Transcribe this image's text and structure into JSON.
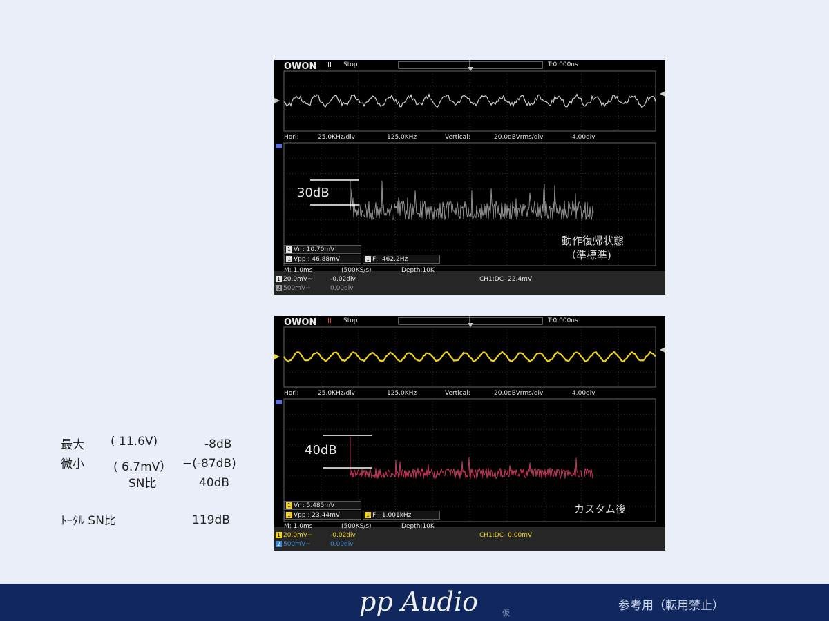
{
  "scope1": {
    "logo": "OWON",
    "run_icon": "II",
    "status": "Stop",
    "trigger_time": "T:0.000ns",
    "fft_info": {
      "hori_label": "Hori:",
      "hori": "25.0KHz/div",
      "center": "125.0KHz",
      "vert_label": "Vertical:",
      "vert": "20.0dBVrms/div",
      "offset": "4.00div"
    },
    "annotation": "30dB",
    "measurements": [
      {
        "ch": "1",
        "text": "Vr : 10.70mV"
      },
      {
        "ch": "1",
        "text": "Vpp : 46.88mV"
      },
      {
        "ch": "1",
        "text": "F : 462.2Hz"
      }
    ],
    "caption_line1": "動作復帰状態",
    "caption_line2": "（準標準)",
    "footer": {
      "timebase": "M: 1.0ms",
      "sample": "(500KS/s)",
      "depth": "Depth:10K",
      "ch1_scale": "20.0mV~",
      "ch1_offset": "-0.02div",
      "ch2_scale": "500mV~",
      "ch2_offset": "0.00div",
      "trigger": "CH1:DC- 22.4mV"
    },
    "trace_color": "#c8c8c8",
    "spectrum_color": "#a8a8a8"
  },
  "scope2": {
    "logo": "OWON",
    "run_icon": "II",
    "status": "Stop",
    "trigger_time": "T:0.000ns",
    "fft_info": {
      "hori_label": "Hori:",
      "hori": "25.0KHz/div",
      "center": "125.0KHz",
      "vert_label": "Vertical:",
      "vert": "20.0dBVrms/div",
      "offset": "4.00div"
    },
    "annotation": "40dB",
    "measurements": [
      {
        "ch": "1",
        "text": "Vr : 5.485mV"
      },
      {
        "ch": "1",
        "text": "Vpp : 23.44mV"
      },
      {
        "ch": "1",
        "text": "F : 1.001kHz"
      }
    ],
    "caption": "カスタム後",
    "footer": {
      "timebase": "M: 1.0ms",
      "sample": "(500KS/s)",
      "depth": "Depth:10K",
      "ch1_scale": "20.0mV~",
      "ch1_offset": "-0.02div",
      "ch2_scale": "500mV~",
      "ch2_offset": "0.00div",
      "trigger": "CH1:DC- 0.00mV"
    },
    "trace_color": "#f2d21a",
    "spectrum_color": "#e8406a"
  },
  "stats": {
    "max_label": "最大",
    "max_voltage": "(   11.6V)",
    "max_db": "-8dB",
    "min_label": "微小",
    "min_voltage": "( 6.7mV）",
    "min_db": "−(-87dB)",
    "sn_label": "SN比",
    "sn_value": "40dB",
    "total_label": "ﾄｰﾀﾙ SN比",
    "total_value": "119dB"
  },
  "footer": {
    "brand": "pp Audio",
    "brand_suffix": "仮",
    "note": "参考用（転用禁止）"
  }
}
